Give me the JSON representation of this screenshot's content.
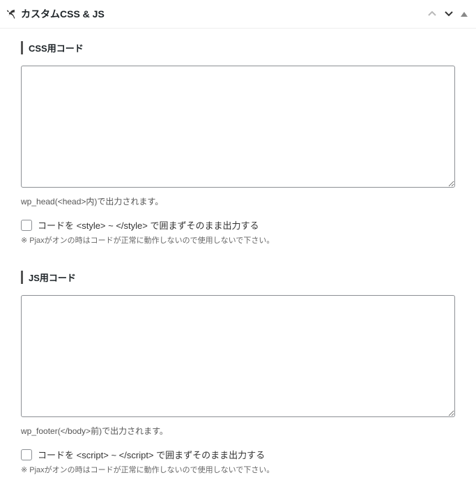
{
  "panel": {
    "title": "カスタムCSS & JS"
  },
  "sections": {
    "css": {
      "heading": "CSS用コード",
      "textarea_value": "",
      "help": "wp_head(<head>内)で出力されます。",
      "checkbox_label": "コードを <style> ~ </style> で囲まずそのまま出力する",
      "note": "※ Pjaxがオンの時はコードが正常に動作しないので使用しないで下さい。"
    },
    "js": {
      "heading": "JS用コード",
      "textarea_value": "",
      "help": "wp_footer(</body>前)で出力されます。",
      "checkbox_label": "コードを <script> ~ </script> で囲まずそのまま出力する",
      "note": "※ Pjaxがオンの時はコードが正常に動作しないので使用しないで下さい。"
    }
  }
}
